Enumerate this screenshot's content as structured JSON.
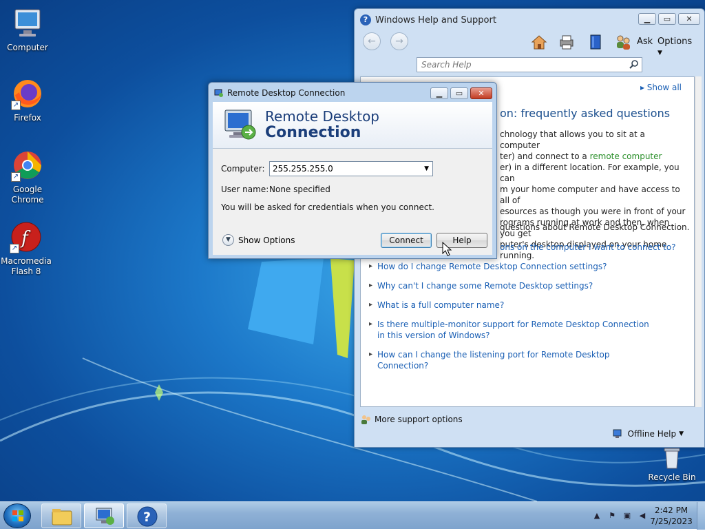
{
  "desktop": {
    "icons": [
      {
        "label": "Computer"
      },
      {
        "label": "Firefox"
      },
      {
        "label": "Google Chrome"
      },
      {
        "label": "Macromedia Flash 8"
      },
      {
        "label": "Recycle Bin"
      }
    ]
  },
  "help_window": {
    "title": "Windows Help and Support",
    "toolbar": {
      "ask_label": "Ask",
      "options_label": "Options"
    },
    "search_placeholder": "Search Help",
    "show_all": "Show all",
    "heading": "on: frequently asked questions",
    "paragraph_lines": [
      "chnology that allows you to sit at a computer",
      "ter) and connect to a ",
      "er) in a different location. For example, you can",
      "m your home computer and have access to all of",
      "esources as though you were in front of your",
      "rograms running at work and then, when you get",
      "puter's desktop displayed on your home",
      "running."
    ],
    "paragraph_link": "remote computer",
    "intro": "questions about Remote Desktop Connection.",
    "faq": [
      "ons on the computer I want to connect to?",
      "How do I change Remote Desktop Connection settings?",
      "Why can't I change some Remote Desktop settings?",
      "What is a full computer name?",
      "Is there multiple-monitor support for Remote Desktop Connection in this version of Windows?",
      "How can I change the listening port for Remote Desktop Connection?"
    ],
    "more_support": "More support options",
    "offline_help": "Offline Help"
  },
  "rdc_dialog": {
    "title": "Remote Desktop Connection",
    "header_line1": "Remote Desktop",
    "header_line2": "Connection",
    "computer_label": "Computer:",
    "computer_value": "255.255.255.0",
    "username_label": "User name:",
    "username_value": "None specified",
    "credentials_note": "You will be asked for credentials when you connect.",
    "show_options": "Show Options",
    "connect_button": "Connect",
    "help_button": "Help"
  },
  "taskbar": {
    "time": "2:42 PM",
    "date": "7/25/2023"
  }
}
